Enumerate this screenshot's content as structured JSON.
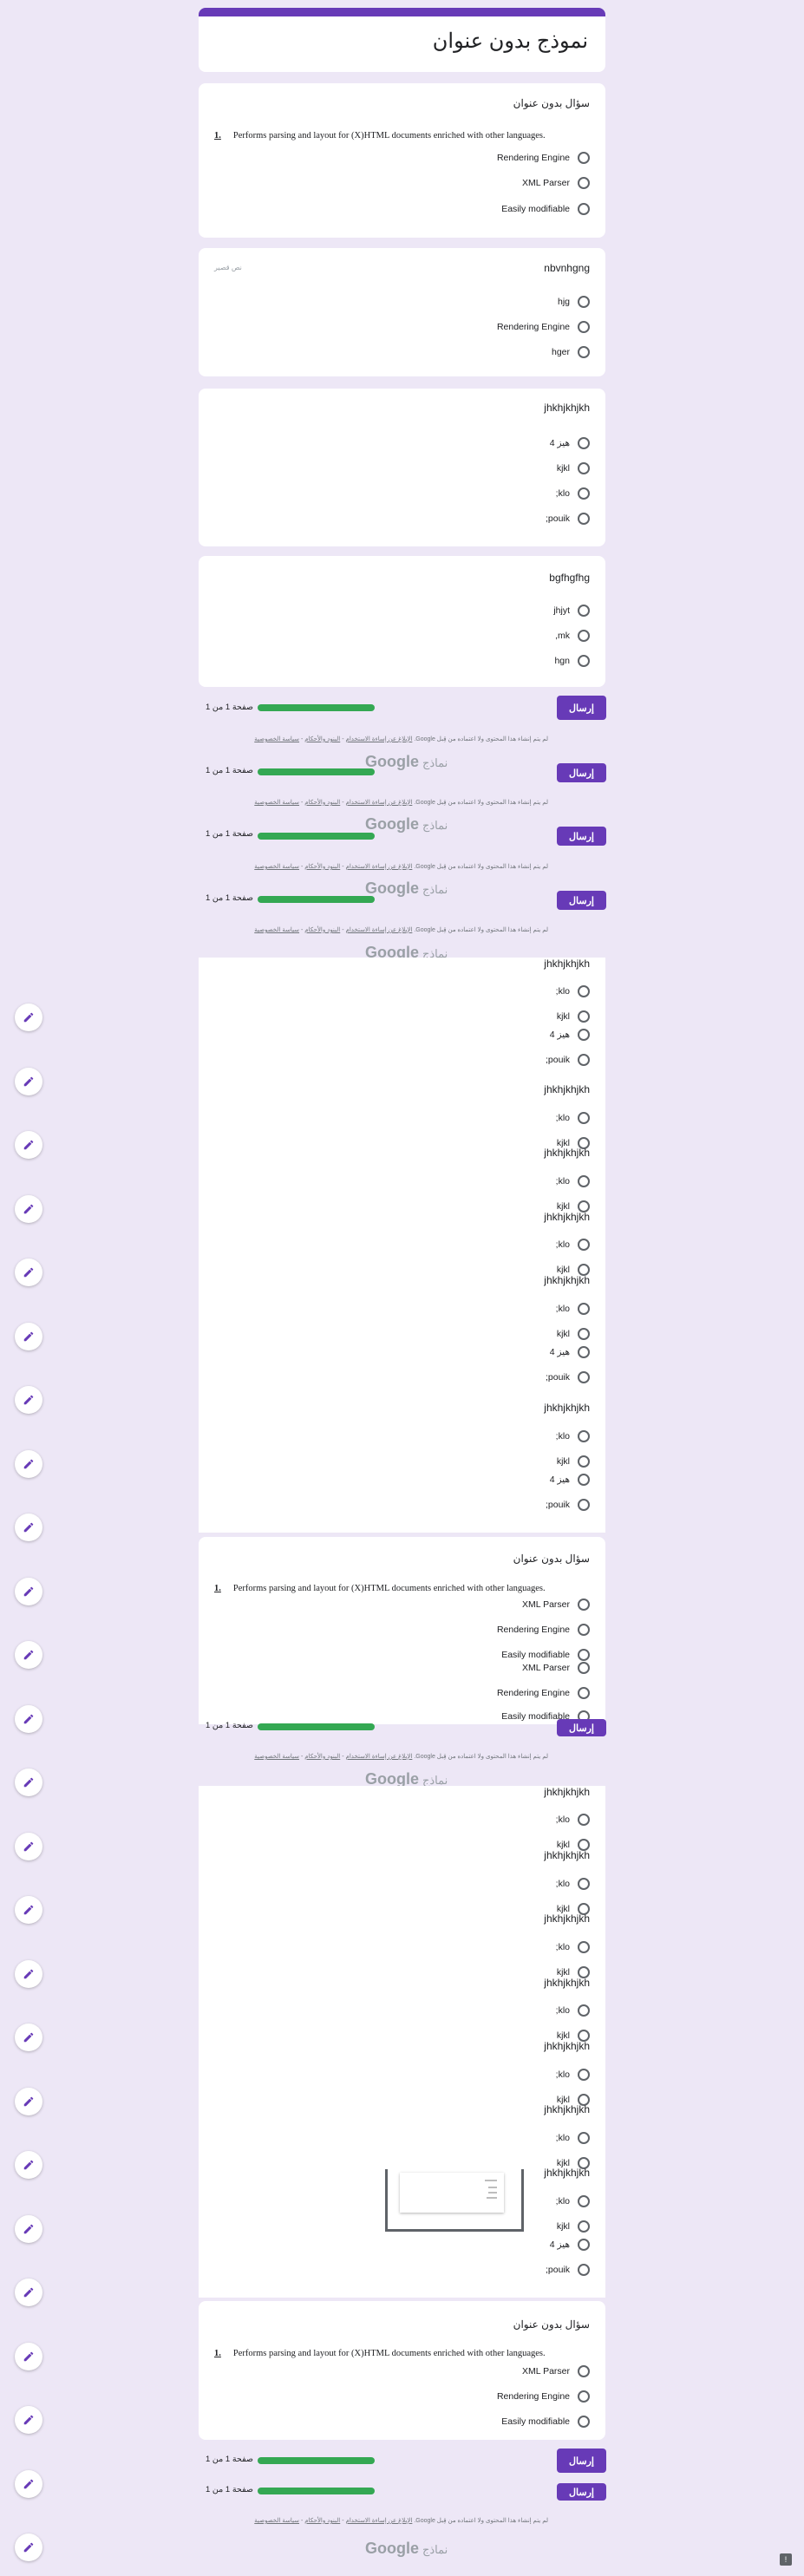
{
  "form": {
    "title": "نموذج بدون عنوان",
    "untitled_question": "سؤال بدون عنوان",
    "desc_num": "1.",
    "desc_text": "Performs parsing and layout for (X)HTML documents enriched with other languages.",
    "q2_title": "nbvnhgng",
    "q2_hint": "نص قصير",
    "q3_title": "jhkhjkhjkh",
    "q4_title": "bgfhgfhg",
    "submit_label": "إرسال",
    "progress_text": "صفحة 1 من 1",
    "progress_value": 1.0,
    "footer_text": "لم يتم إنشاء هذا المحتوى ولا اعتماده من قِبل Google.",
    "footer_link1": "الإبلاغ عن إساءة الاستخدام",
    "footer_link2": "البنود والأحكام",
    "footer_link3": "سياسة الخصوصية",
    "logo_text": "Google",
    "logo_sub": "نماذج",
    "opts": {
      "rendering": "Rendering Engine",
      "xml": "XML Parser",
      "easily": "Easily modifiable",
      "hjg": "hjg",
      "hger": "hger",
      "hiz": "هيز 4",
      "kjkl": "kjkl",
      "klo": "klo;",
      "pouik": "pouik;",
      "jhjyt": "jhjyt",
      "mk": "mk,",
      "hgn": "hgn"
    }
  },
  "icons": {
    "edit": "pencil-icon",
    "report": "report-icon"
  },
  "colors": {
    "accent": "#673ab7",
    "progress": "#34a853",
    "background": "#ede7f6"
  }
}
